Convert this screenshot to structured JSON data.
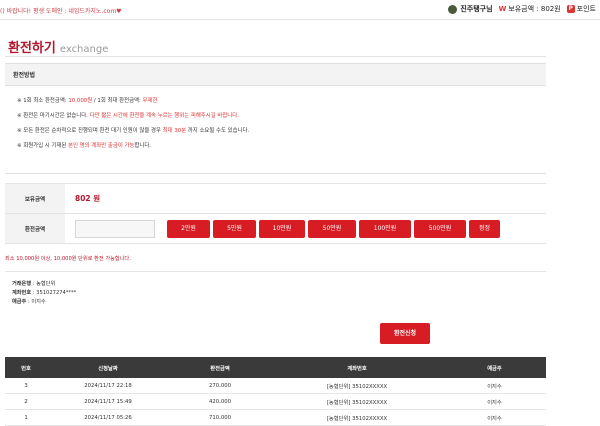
{
  "topbar": {
    "marquee": "()  바랍니다! 평생 도메인 : 네임드카지노.com♥"
  },
  "user": {
    "name": "진주탱구님",
    "balance_label": "보유금액 : 802원",
    "won_symbol": "W",
    "point_label": "포인트",
    "point_symbol": "P"
  },
  "title": {
    "ko": "환전하기",
    "en": "exchange"
  },
  "method": {
    "heading": "환전방법",
    "lines": [
      [
        "※ 1회 최소 환전금액: ",
        "10,000원",
        " / 1회 최대 환전금액: ",
        "무제한"
      ],
      [
        "※ 환전은 마기시간은 없습니다. ",
        "다만 짧은 시간에 환전을 계속 누르는 행위는 피해주시길 바랍니다.",
        "",
        ""
      ],
      [
        "※ 모든 환전은 순차적으로 진행되며 환전 대기 인원이 많을 경우 ",
        "최대 30분",
        " 까지 소요될 수도 있습니다.",
        ""
      ],
      [
        "※ 회원가입 시 기재된 ",
        "본인 명의 계좌만 출금이 가능",
        "합니다.",
        ""
      ]
    ]
  },
  "form": {
    "balance_label": "보유금액",
    "balance_value": "802 원",
    "amount_label": "환전금액",
    "amount_value": "",
    "buttons": [
      "2만원",
      "5만원",
      "10만원",
      "50만원",
      "100만원",
      "500만원",
      "정정"
    ],
    "note": "최소 10,000원 이상, 10,000원  단위로 환전 가능합니다."
  },
  "account": {
    "bank_label": "거래은행",
    "bank_value": "농협단위",
    "number_label": "계좌번호",
    "number_value": "351027274****",
    "holder_label": "예금주",
    "holder_value": "이지수"
  },
  "apply_button": "환전신청",
  "history": {
    "headers": [
      "번호",
      "신청날짜",
      "환전금액",
      "계좌번호",
      "예금주"
    ],
    "rows": [
      [
        "3",
        "2024/11/17 22:18",
        "270,000",
        "[농협단위] 35102XXXXX",
        "이지수"
      ],
      [
        "2",
        "2024/11/17 15:49",
        "420,000",
        "[농협단위] 35102XXXXX",
        "이지수"
      ],
      [
        "1",
        "2024/11/17 05:26",
        "710,000",
        "[농협단위] 35102XXXXX",
        "이지수"
      ]
    ]
  }
}
